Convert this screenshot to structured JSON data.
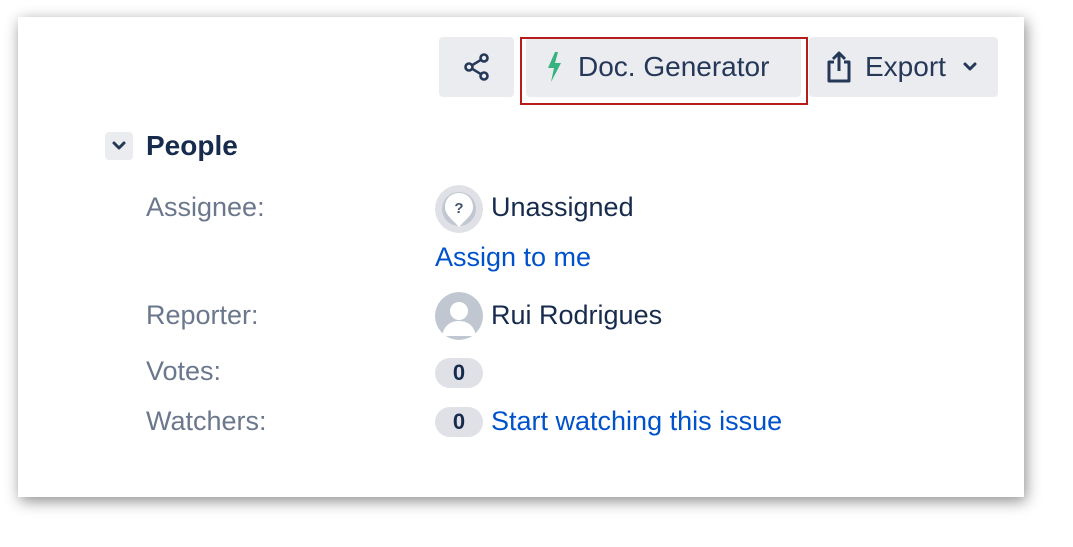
{
  "toolbar": {
    "share_icon": "share-icon",
    "doc_generator_label": "Doc. Generator",
    "doc_generator_icon": "bolt-icon",
    "doc_generator_icon_color": "#36b37e",
    "export_label": "Export",
    "export_icon": "upload-icon"
  },
  "people": {
    "title": "People",
    "assignee": {
      "label": "Assignee:",
      "value": "Unassigned",
      "action": "Assign to me"
    },
    "reporter": {
      "label": "Reporter:",
      "value": "Rui Rodrigues"
    },
    "votes": {
      "label": "Votes:",
      "count": "0"
    },
    "watchers": {
      "label": "Watchers:",
      "count": "0",
      "action": "Start watching this issue"
    }
  },
  "colors": {
    "link": "#0052cc",
    "label": "#6b778c",
    "text": "#172b4d",
    "highlight_border": "#b71c1c"
  }
}
